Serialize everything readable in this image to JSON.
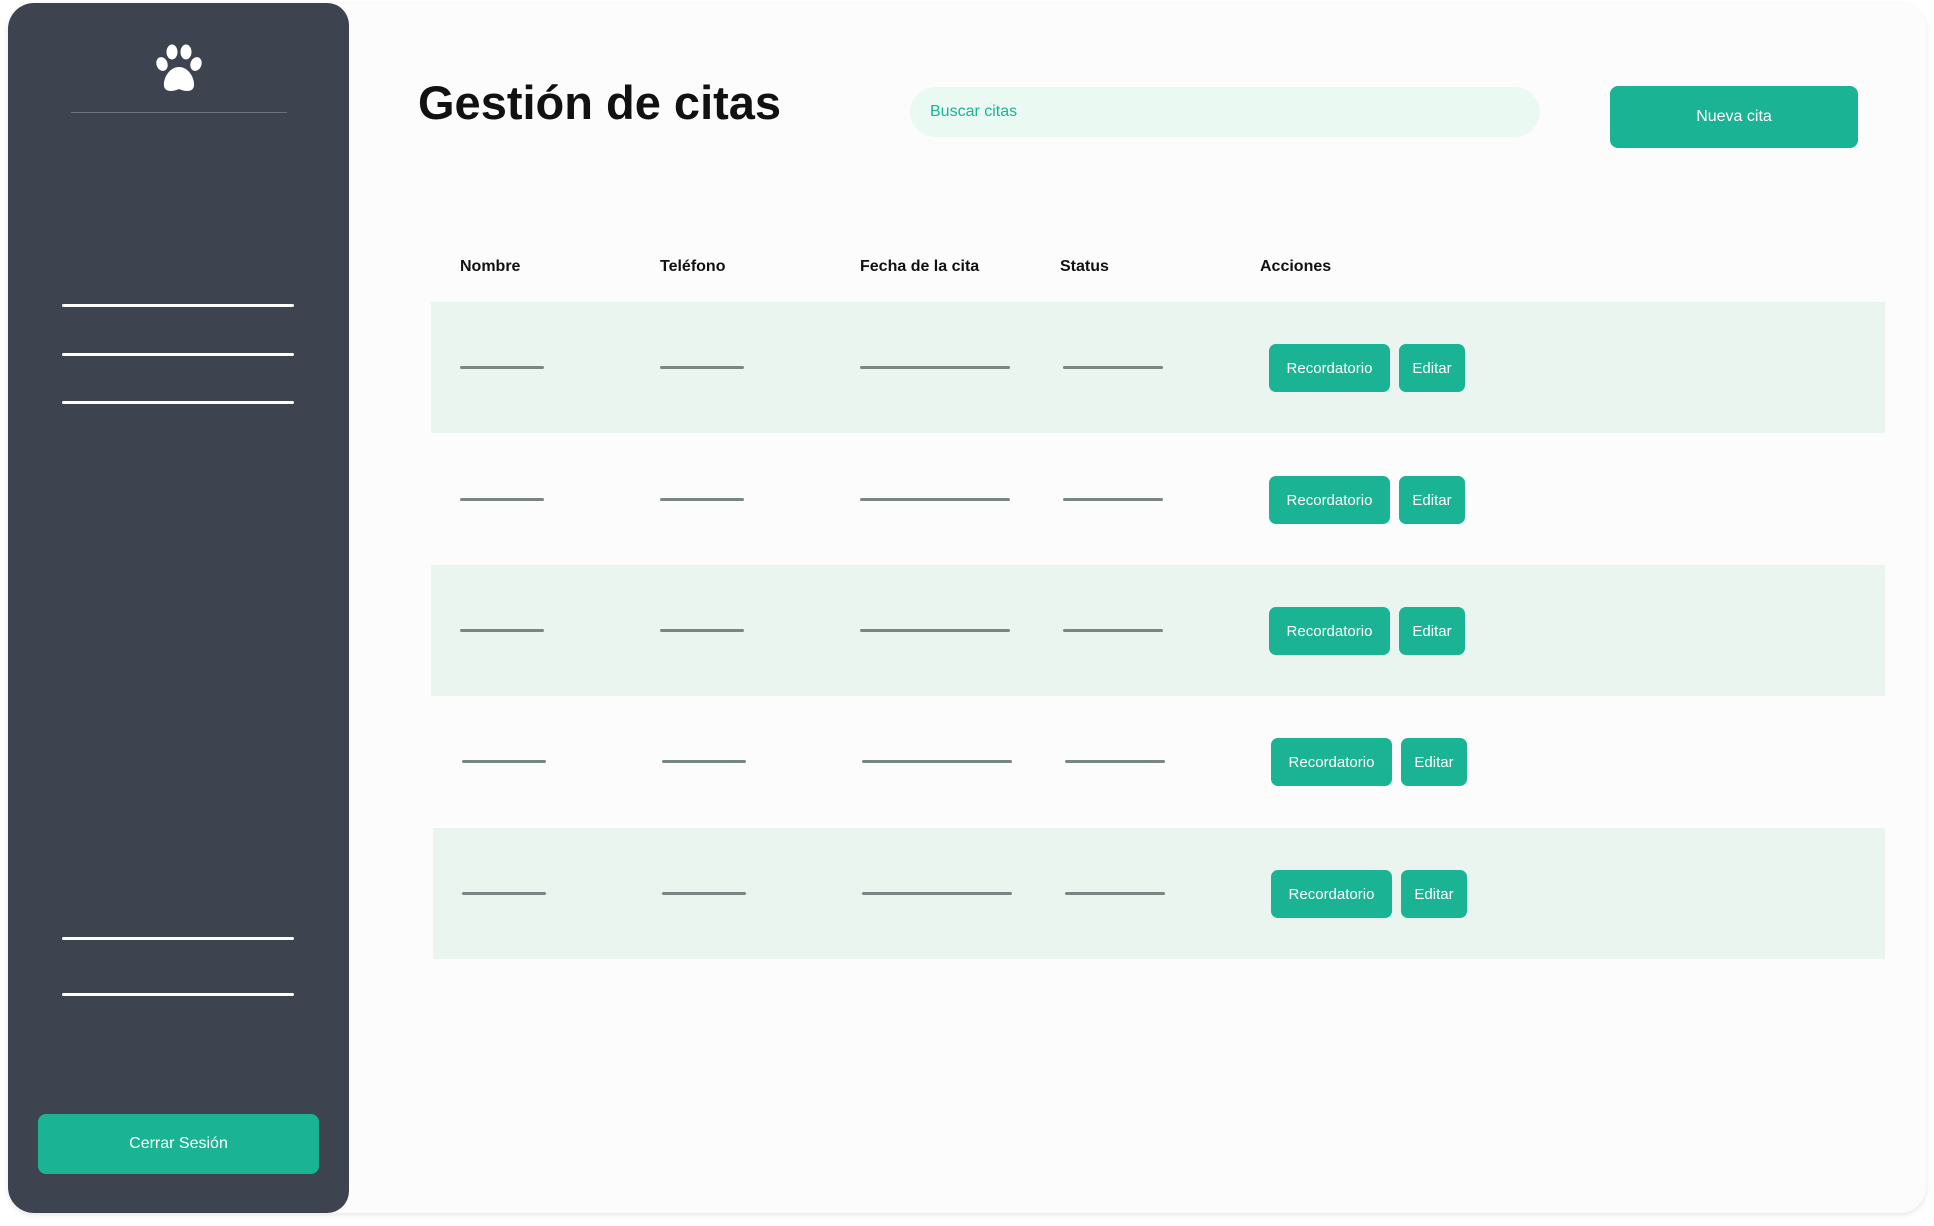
{
  "sidebar": {
    "logo_icon": "paw-icon",
    "nav_items": [
      "",
      "",
      "",
      "",
      ""
    ],
    "logout_label": "Cerrar Sesión"
  },
  "header": {
    "title": "Gestión de citas",
    "search_placeholder": "Buscar citas",
    "new_button_label": "Nueva cita"
  },
  "table": {
    "columns": [
      "Nombre",
      "Teléfono",
      "Fecha de la cita",
      "Status",
      "Acciones"
    ],
    "rows": [
      {
        "reminder_label": "Recordatorio",
        "edit_label": "Editar"
      },
      {
        "reminder_label": "Recordatorio",
        "edit_label": "Editar"
      },
      {
        "reminder_label": "Recordatorio",
        "edit_label": "Editar"
      },
      {
        "reminder_label": "Recordatorio",
        "edit_label": "Editar"
      },
      {
        "reminder_label": "Recordatorio",
        "edit_label": "Editar"
      }
    ]
  },
  "colors": {
    "sidebar_bg": "#3d4450",
    "accent": "#1ab394",
    "row_shade": "#ebf5ef",
    "search_bg": "#eafaf2",
    "placeholder_line": "#7a8684"
  }
}
